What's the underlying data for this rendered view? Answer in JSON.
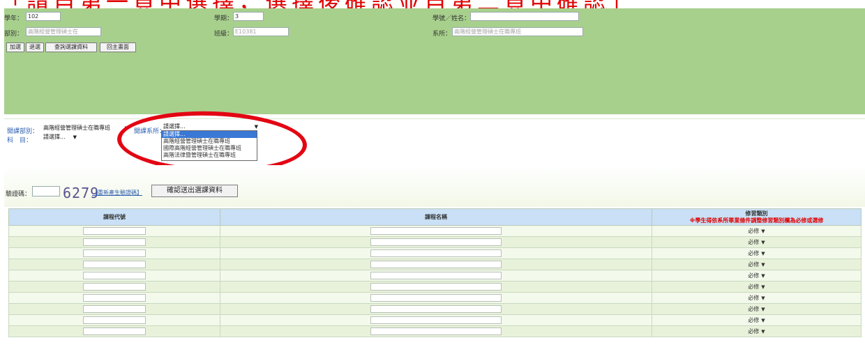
{
  "banner": {
    "text": "「請自第一頁中選擇，選擇後確認並自第二頁中確認」"
  },
  "student": {
    "year_label": "學年：",
    "year_value": "102",
    "term_label": "學期：",
    "term_value": "3",
    "id_label": "學號／姓名：",
    "id_value": "",
    "dept_label": "部別：",
    "dept_value": "高階經營管理碩士在",
    "class_label": "班級：",
    "class_value": "E10381",
    "school_label": "系所：",
    "school_value": "高階經營管理碩士在職專班"
  },
  "buttons": {
    "add": "加選",
    "drop": "退選",
    "query": "查詢選課資料",
    "home": "回主畫面"
  },
  "filter": {
    "dept_label": "開課部別：",
    "dept_value": "高階經營管理碩士在職專班",
    "school_label": "開課系所：",
    "school_value": "請選擇...",
    "subject_label": "科　目：",
    "subject_value": "請選擇...",
    "school_options": [
      "請選擇...",
      "高階經營管理碩士在職專班",
      "國際高階經營管理碩士在職專班",
      "高階法律暨管理碩士在職專班"
    ]
  },
  "verify": {
    "label": "驗證碼：",
    "code": "6279",
    "regen_link": "【重新產生驗證碼】",
    "confirm_button": "確認送出選課資料"
  },
  "table": {
    "col_code": "課程代號",
    "col_name": "課程名稱",
    "col_type": "修習類別",
    "col_type_note": "※學生得依系所畢業條件調整修習類別欄為必修或選修",
    "default_type": "必修",
    "row_count": 10
  }
}
